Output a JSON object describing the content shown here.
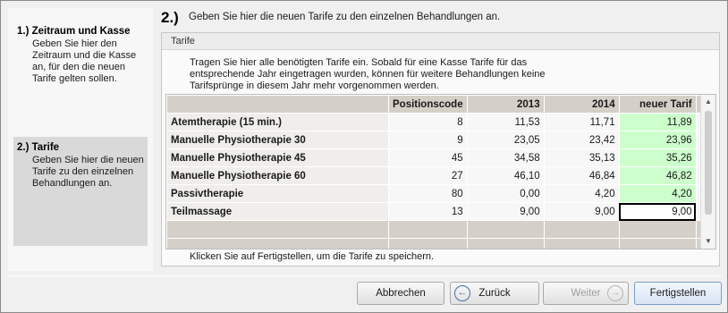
{
  "steps": [
    {
      "title": "1.) Zeitraum und Kasse",
      "desc": "Geben Sie hier den Zeitraum und die Kasse an, für den die neuen Tarife gelten sollen."
    },
    {
      "title": "2.) Tarife",
      "desc": "Geben Sie hier die neuen Tarife zu den einzelnen Behandlungen an."
    }
  ],
  "header": {
    "num": "2.)",
    "text": "Geben Sie hier die neuen Tarife zu den einzelnen Behandlungen an."
  },
  "group": {
    "title": "Tarife",
    "intro": "Tragen Sie hier alle benötigten Tarife ein. Sobald für eine Kasse Tarife für das entsprechende Jahr eingetragen wurden, können für weitere Behandlungen keine Tarifsprünge in diesem Jahr mehr vorgenommen werden.",
    "hint": "Klicken Sie auf Fertigstellen, um die Tarife zu speichern."
  },
  "table": {
    "columns": [
      "",
      "Positionscode",
      "2013",
      "2014",
      "neuer Tarif"
    ],
    "rows": [
      {
        "name": "Atemtherapie (15 min.)",
        "code": "8",
        "y2013": "11,53",
        "y2014": "11,71",
        "neu": "11,89"
      },
      {
        "name": "Manuelle Physiotherapie 30",
        "code": "9",
        "y2013": "23,05",
        "y2014": "23,42",
        "neu": "23,96"
      },
      {
        "name": "Manuelle Physiotherapie 45",
        "code": "45",
        "y2013": "34,58",
        "y2014": "35,13",
        "neu": "35,26"
      },
      {
        "name": "Manuelle Physiotherapie 60",
        "code": "27",
        "y2013": "46,10",
        "y2014": "46,84",
        "neu": "46,82"
      },
      {
        "name": "Passivtherapie",
        "code": "80",
        "y2013": "0,00",
        "y2014": "4,20",
        "neu": "4,20"
      },
      {
        "name": "Teilmassage",
        "code": "13",
        "y2013": "9,00",
        "y2014": "9,00",
        "neu": "9,00"
      }
    ]
  },
  "buttons": {
    "cancel": "Abbrechen",
    "back": "Zurück",
    "next": "Weiter",
    "finish": "Fertigstellen"
  },
  "icons": {
    "back": "arrow-left-circle-icon",
    "next": "arrow-right-circle-icon"
  },
  "colors": {
    "new_tariff_bg": "#ccffcc",
    "grid_bg": "#d4d0c8"
  }
}
